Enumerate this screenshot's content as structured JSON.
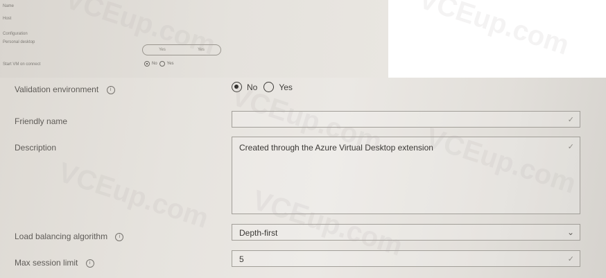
{
  "top_panel": {
    "name_label": "Name",
    "host_label": "Host",
    "configuration_label": "Configuration",
    "personal_desktop_label": "Personal desktop",
    "toggle_no": "Yes",
    "toggle_yes": "Yes",
    "start_vm_label": "Start VM on connect",
    "start_vm_no": "No",
    "start_vm_yes": "Yes"
  },
  "form": {
    "validation_environment": {
      "label": "Validation environment",
      "selected": "No",
      "options": [
        "No",
        "Yes"
      ]
    },
    "friendly_name": {
      "label": "Friendly name",
      "value": ""
    },
    "description": {
      "label": "Description",
      "value": "Created through the Azure Virtual Desktop extension"
    },
    "load_balancing": {
      "label": "Load balancing algorithm",
      "value": "Depth-first"
    },
    "max_session_limit": {
      "label": "Max session limit",
      "value": "5"
    }
  },
  "icons": {
    "info": "info-icon",
    "check": "checkmark-icon",
    "chevron": "chevron-down-icon"
  },
  "watermark": "VCEup.com"
}
